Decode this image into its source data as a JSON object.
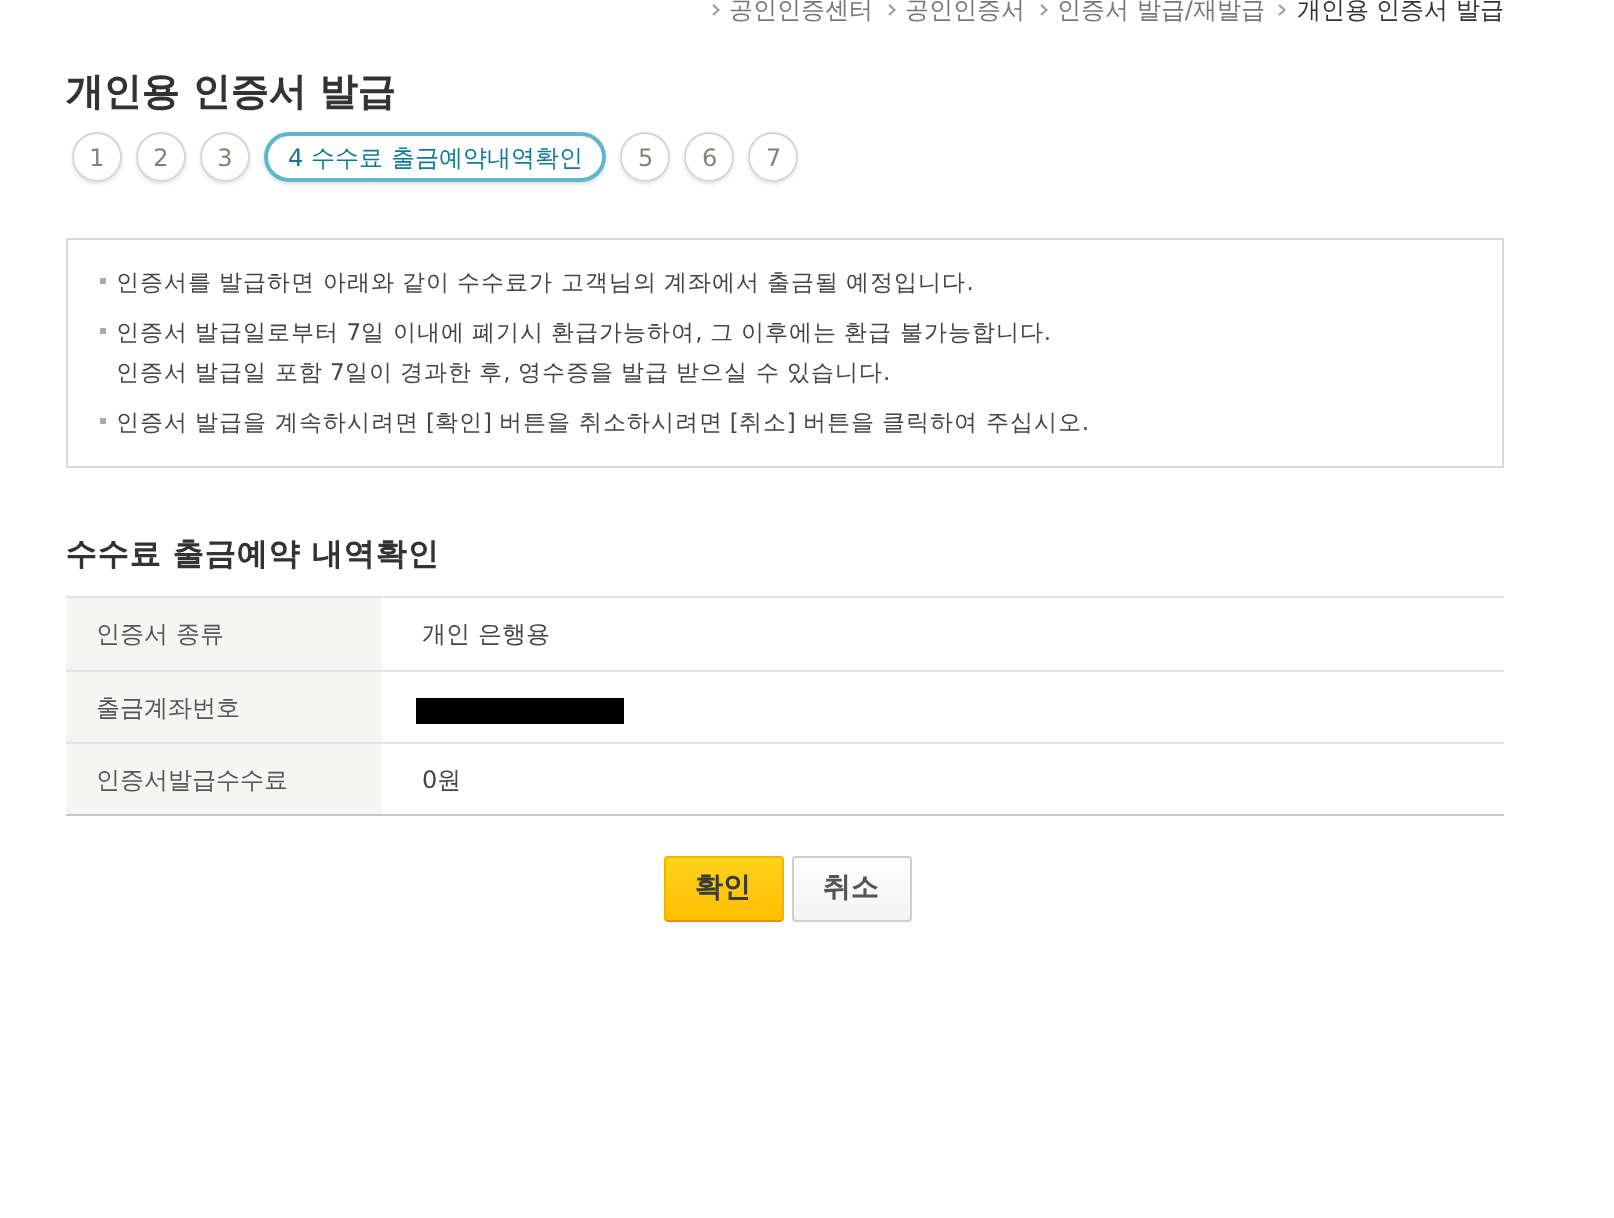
{
  "breadcrumb": [
    {
      "label": "공인인증센터",
      "current": false
    },
    {
      "label": "공인인증서",
      "current": false
    },
    {
      "label": "인증서 발급/재발급",
      "current": false
    },
    {
      "label": "개인용 인증서 발급",
      "current": true
    }
  ],
  "title": "개인용 인증서 발급",
  "steps": [
    {
      "number": "1",
      "selected": false
    },
    {
      "number": "2",
      "selected": false
    },
    {
      "number": "3",
      "selected": false
    },
    {
      "number": "4",
      "label": "수수료 출금예약내역확인",
      "selected": true
    },
    {
      "number": "5",
      "selected": false
    },
    {
      "number": "6",
      "selected": false
    },
    {
      "number": "7",
      "selected": false
    }
  ],
  "notice": [
    {
      "lines": [
        "인증서를 발급하면 아래와 같이 수수료가 고객님의 계좌에서 출금될 예정입니다."
      ]
    },
    {
      "lines": [
        "인증서 발급일로부터 7일 이내에 폐기시 환급가능하여, 그 이후에는 환급 불가능합니다.",
        "인증서 발급일 포함 7일이 경과한 후, 영수증을 발급 받으실 수 있습니다."
      ]
    },
    {
      "lines": [
        "인증서 발급을 계속하시려면 [확인] 버튼을 취소하시려면 [취소] 버튼을 클릭하여 주십시오."
      ]
    }
  ],
  "section_title": "수수료 출금예약 내역확인",
  "table": {
    "rows": [
      {
        "label": "인증서 종류",
        "kind": "text",
        "value": "개인 은행용"
      },
      {
        "label": "출금계좌번호",
        "kind": "redacted"
      },
      {
        "label": "인증서발급수수료",
        "kind": "text",
        "value": "0원"
      }
    ]
  },
  "buttons": [
    {
      "label": "확인",
      "kind": "primary"
    },
    {
      "label": "취소",
      "kind": "secondary"
    }
  ]
}
